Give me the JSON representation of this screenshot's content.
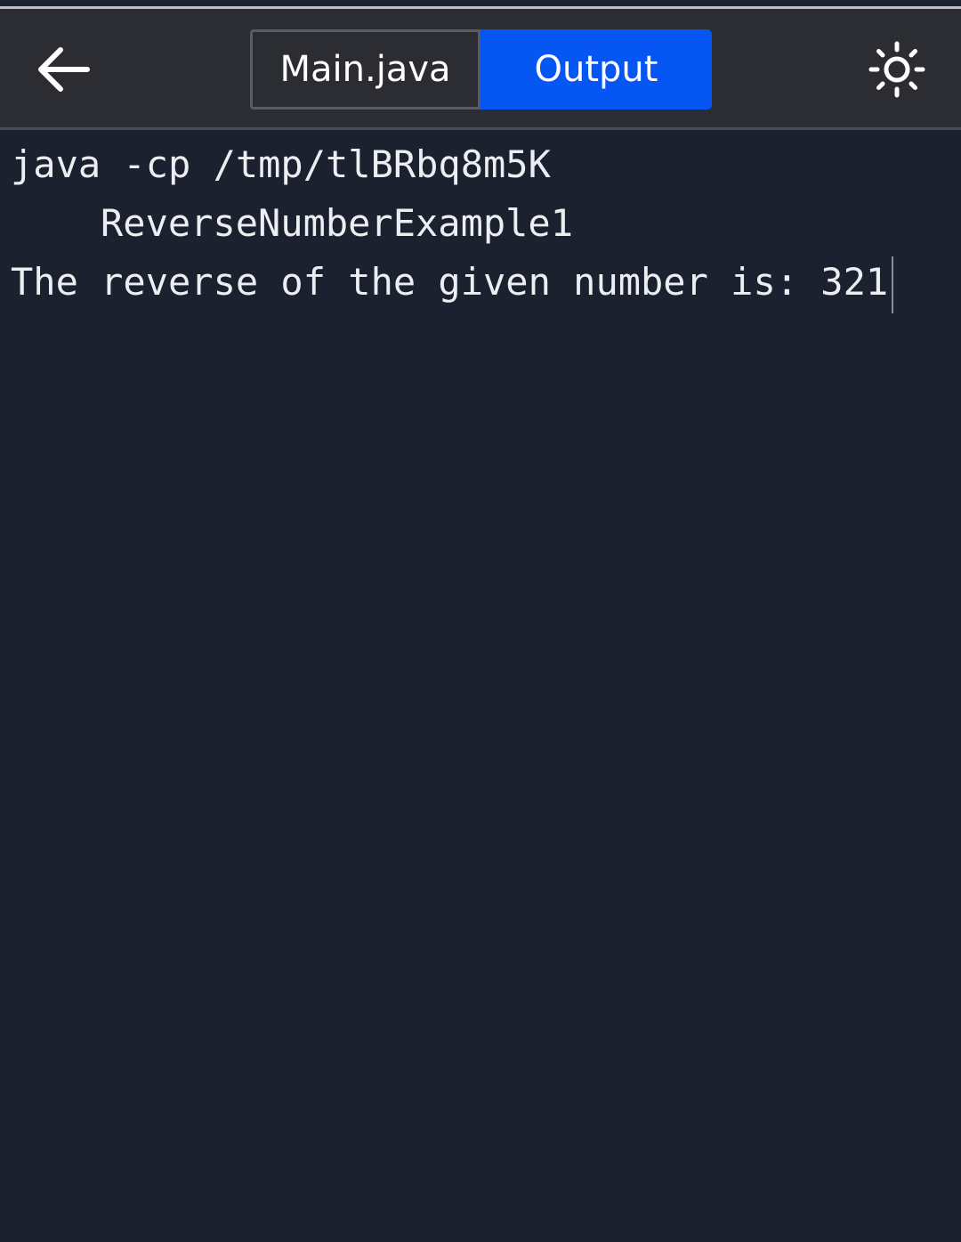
{
  "toolbar": {
    "back_icon": "arrow-left-icon",
    "tabs": [
      {
        "label": "Main.java",
        "active": false
      },
      {
        "label": "Output",
        "active": true
      }
    ],
    "theme_icon": "sun-icon"
  },
  "console": {
    "lines": [
      "java -cp /tmp/tlBRbq8m5K",
      "ReverseNumberExample1",
      "The reverse of the given number is: 321"
    ]
  },
  "colors": {
    "background": "#1c2130",
    "toolbar": "#2b2d33",
    "active_tab": "#0556f3",
    "text": "#eceef2"
  }
}
